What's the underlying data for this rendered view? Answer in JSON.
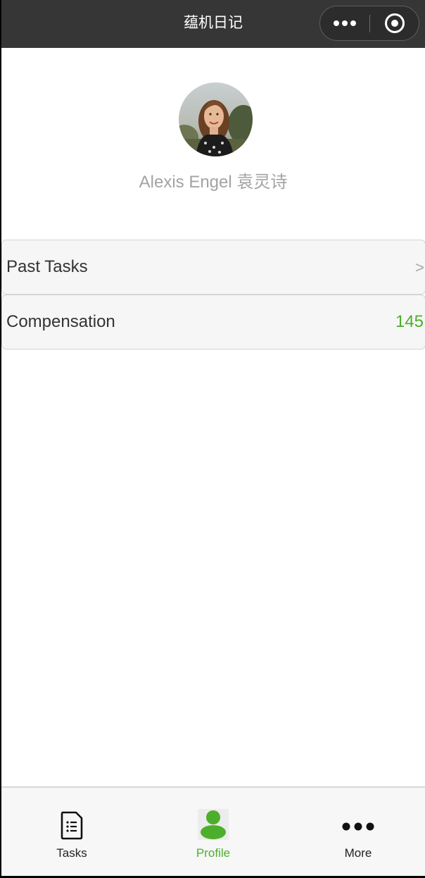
{
  "nav": {
    "title": "蕴机日记",
    "bg_color": "#363636",
    "more_icon": "more-dots-icon",
    "close_icon": "target-close-icon"
  },
  "profile": {
    "name": "Alexis Engel 袁灵诗",
    "avatar_icon": "user-avatar-photo"
  },
  "menu": {
    "past_tasks": {
      "label": "Past Tasks",
      "arrow": ">"
    },
    "compensation": {
      "label": "Compensation",
      "value": "145",
      "value_color": "#4dae2c"
    }
  },
  "tabbar": {
    "accent_color": "#4dae2c",
    "tabs": [
      {
        "label": "Tasks",
        "icon": "list-document-icon",
        "active": false
      },
      {
        "label": "Profile",
        "icon": "person-icon",
        "active": true
      },
      {
        "label": "More",
        "icon": "more-dots-icon",
        "active": false
      }
    ]
  }
}
